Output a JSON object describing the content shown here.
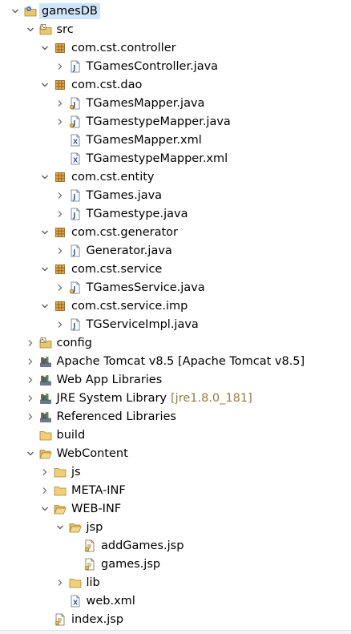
{
  "tree": [
    {
      "label": "gamesDB",
      "depth": 0,
      "toggle": "open",
      "icon": "project-icon",
      "selected": true
    },
    {
      "label": "src",
      "depth": 1,
      "toggle": "open",
      "icon": "source-folder-icon"
    },
    {
      "label": "com.cst.controller",
      "depth": 2,
      "toggle": "open",
      "icon": "package-icon"
    },
    {
      "label": "TGamesController.java",
      "depth": 3,
      "toggle": "closed",
      "icon": "java-file-icon"
    },
    {
      "label": "com.cst.dao",
      "depth": 2,
      "toggle": "open",
      "icon": "package-icon"
    },
    {
      "label": "TGamesMapper.java",
      "depth": 3,
      "toggle": "closed",
      "icon": "java-interface-icon"
    },
    {
      "label": "TGamestypeMapper.java",
      "depth": 3,
      "toggle": "closed",
      "icon": "java-interface-icon"
    },
    {
      "label": "TGamesMapper.xml",
      "depth": 3,
      "toggle": "none",
      "icon": "xml-file-icon"
    },
    {
      "label": "TGamestypeMapper.xml",
      "depth": 3,
      "toggle": "none",
      "icon": "xml-file-icon"
    },
    {
      "label": "com.cst.entity",
      "depth": 2,
      "toggle": "open",
      "icon": "package-icon"
    },
    {
      "label": "TGames.java",
      "depth": 3,
      "toggle": "closed",
      "icon": "java-file-icon"
    },
    {
      "label": "TGamestype.java",
      "depth": 3,
      "toggle": "closed",
      "icon": "java-file-icon"
    },
    {
      "label": "com.cst.generator",
      "depth": 2,
      "toggle": "open",
      "icon": "package-icon"
    },
    {
      "label": "Generator.java",
      "depth": 3,
      "toggle": "closed",
      "icon": "java-file-icon"
    },
    {
      "label": "com.cst.service",
      "depth": 2,
      "toggle": "open",
      "icon": "package-icon"
    },
    {
      "label": "TGamesService.java",
      "depth": 3,
      "toggle": "closed",
      "icon": "java-interface-icon"
    },
    {
      "label": "com.cst.service.imp",
      "depth": 2,
      "toggle": "open",
      "icon": "package-icon"
    },
    {
      "label": "TGServiceImpl.java",
      "depth": 3,
      "toggle": "closed",
      "icon": "java-file-icon"
    },
    {
      "label": "config",
      "depth": 1,
      "toggle": "closed",
      "icon": "source-folder-icon"
    },
    {
      "label": "Apache Tomcat v8.5 [Apache Tomcat v8.5]",
      "depth": 1,
      "toggle": "closed",
      "icon": "library-icon"
    },
    {
      "label": "Web App Libraries",
      "depth": 1,
      "toggle": "closed",
      "icon": "library-icon"
    },
    {
      "label": "JRE System Library",
      "decoration": "[jre1.8.0_181]",
      "depth": 1,
      "toggle": "closed",
      "icon": "library-icon"
    },
    {
      "label": "Referenced Libraries",
      "depth": 1,
      "toggle": "closed",
      "icon": "library-icon"
    },
    {
      "label": "build",
      "depth": 1,
      "toggle": "none",
      "icon": "folder-icon"
    },
    {
      "label": "WebContent",
      "depth": 1,
      "toggle": "open",
      "icon": "folder-open-icon"
    },
    {
      "label": "js",
      "depth": 2,
      "toggle": "closed",
      "icon": "folder-icon"
    },
    {
      "label": "META-INF",
      "depth": 2,
      "toggle": "closed",
      "icon": "folder-icon"
    },
    {
      "label": "WEB-INF",
      "depth": 2,
      "toggle": "open",
      "icon": "folder-open-icon"
    },
    {
      "label": "jsp",
      "depth": 3,
      "toggle": "open",
      "icon": "folder-open-icon"
    },
    {
      "label": "addGames.jsp",
      "depth": 4,
      "toggle": "none",
      "icon": "jsp-file-icon"
    },
    {
      "label": "games.jsp",
      "depth": 4,
      "toggle": "none",
      "icon": "jsp-file-icon"
    },
    {
      "label": "lib",
      "depth": 3,
      "toggle": "closed",
      "icon": "folder-icon"
    },
    {
      "label": "web.xml",
      "depth": 3,
      "toggle": "none",
      "icon": "xml-file-icon"
    },
    {
      "label": "index.jsp",
      "depth": 2,
      "toggle": "none",
      "icon": "jsp-file-icon"
    }
  ]
}
